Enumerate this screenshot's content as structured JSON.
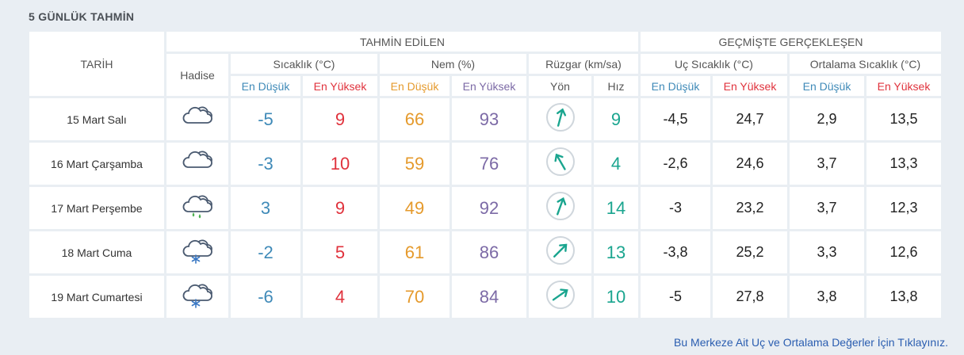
{
  "title": "5 GÜNLÜK TAHMİN",
  "headers": {
    "tarih": "TARİH",
    "tahmin": "TAHMİN EDİLEN",
    "gecmis": "GEÇMİŞTE GERÇEKLEŞEN",
    "hadise": "Hadise",
    "sicaklik": "Sıcaklık (°C)",
    "nem": "Nem (%)",
    "ruzgar": "Rüzgar (km/sa)",
    "uc": "Uç Sıcaklık (°C)",
    "ortalama": "Ortalama Sıcaklık (°C)",
    "en_dusuk": "En Düşük",
    "en_yuksek": "En Yüksek",
    "yon": "Yön",
    "hiz": "Hız"
  },
  "rows": [
    {
      "date": "15 Mart Salı",
      "icon": "cloudy-icon",
      "temp_low": "-5",
      "temp_high": "9",
      "hum_low": "66",
      "hum_high": "93",
      "wind_dir_deg": 195,
      "wind_speed": "9",
      "ext_low": "-4,5",
      "ext_high": "24,7",
      "avg_low": "2,9",
      "avg_high": "13,5"
    },
    {
      "date": "16 Mart Çarşamba",
      "icon": "cloudy-icon",
      "temp_low": "-3",
      "temp_high": "10",
      "hum_low": "59",
      "hum_high": "76",
      "wind_dir_deg": 150,
      "wind_speed": "4",
      "ext_low": "-2,6",
      "ext_high": "24,6",
      "avg_low": "3,7",
      "avg_high": "13,3"
    },
    {
      "date": "17 Mart Perşembe",
      "icon": "rain-icon",
      "temp_low": "3",
      "temp_high": "9",
      "hum_low": "49",
      "hum_high": "92",
      "wind_dir_deg": 200,
      "wind_speed": "14",
      "ext_low": "-3",
      "ext_high": "23,2",
      "avg_low": "3,7",
      "avg_high": "12,3"
    },
    {
      "date": "18 Mart Cuma",
      "icon": "snow-icon",
      "temp_low": "-2",
      "temp_high": "5",
      "hum_low": "61",
      "hum_high": "86",
      "wind_dir_deg": 225,
      "wind_speed": "13",
      "ext_low": "-3,8",
      "ext_high": "25,2",
      "avg_low": "3,3",
      "avg_high": "12,6"
    },
    {
      "date": "19 Mart Cumartesi",
      "icon": "snow-icon",
      "temp_low": "-6",
      "temp_high": "4",
      "hum_low": "70",
      "hum_high": "84",
      "wind_dir_deg": 235,
      "wind_speed": "10",
      "ext_low": "-5",
      "ext_high": "27,8",
      "avg_low": "3,8",
      "avg_high": "13,8"
    }
  ],
  "footer_link": "Bu Merkeze Ait Uç ve Ortalama Değerler İçin Tıklayınız.",
  "colors": {
    "low": "#3f8ab8",
    "high": "#e0323c",
    "hum_low": "#e59a2c",
    "hum_high": "#7c6aa6",
    "wind": "#1aa58f"
  }
}
